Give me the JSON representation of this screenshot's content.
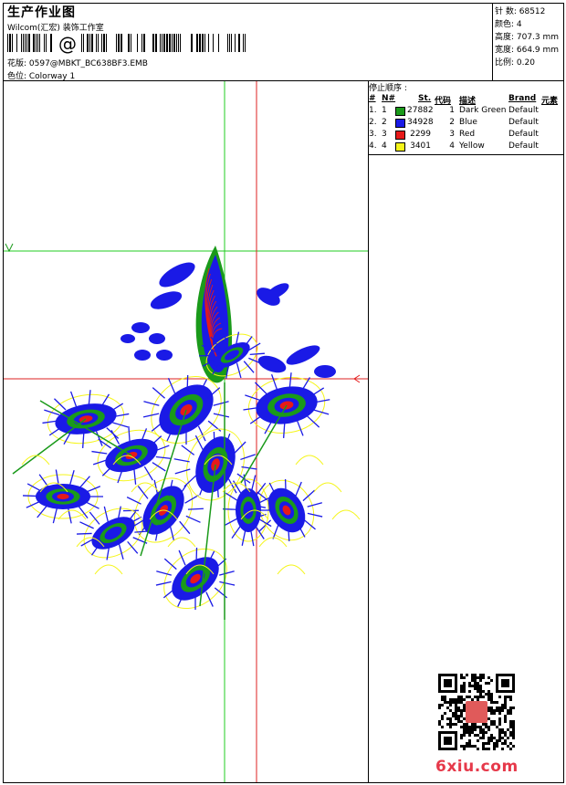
{
  "header": {
    "title": "生产作业图",
    "company": "Wilcom(汇宏) 装饰工作室",
    "design_label": "花版: 0597@MBKT_BC638BF3.EMB",
    "colorway_label": "色位: Colorway 1"
  },
  "stats": [
    {
      "label": "针 数",
      "value": "68512"
    },
    {
      "label": "颜色",
      "value": "4"
    },
    {
      "label": "高度",
      "value": "707.3 mm"
    },
    {
      "label": "宽度",
      "value": "664.9 mm"
    },
    {
      "label": "比例",
      "value": "0.20"
    }
  ],
  "stop_sequence": {
    "title": "停止顺序 :",
    "headers": [
      "#",
      "N#",
      "St.",
      "代码",
      "描述",
      "Brand",
      "元素"
    ],
    "rows": [
      {
        "num": "1.",
        "n": "1",
        "color": "#1a9a1a",
        "st": "27882",
        "code": "1",
        "desc": "Dark Green",
        "brand": "Default"
      },
      {
        "num": "2.",
        "n": "2",
        "color": "#1a1ae6",
        "st": "34928",
        "code": "2",
        "desc": "Blue",
        "brand": "Default"
      },
      {
        "num": "3.",
        "n": "3",
        "color": "#e61a1a",
        "st": "2299",
        "code": "3",
        "desc": "Red",
        "brand": "Default"
      },
      {
        "num": "4.",
        "n": "4",
        "color": "#f5f51a",
        "st": "3401",
        "code": "4",
        "desc": "Yellow",
        "brand": "Default"
      }
    ]
  },
  "watermark": "6xiu.com",
  "colors": {
    "green": "#1a9a1a",
    "blue": "#1a1ae6",
    "red": "#e61a1a",
    "yellow": "#f5f51a",
    "guide_green": "#22cc22",
    "guide_red": "#dd2222",
    "watermark": "#e6394a"
  }
}
